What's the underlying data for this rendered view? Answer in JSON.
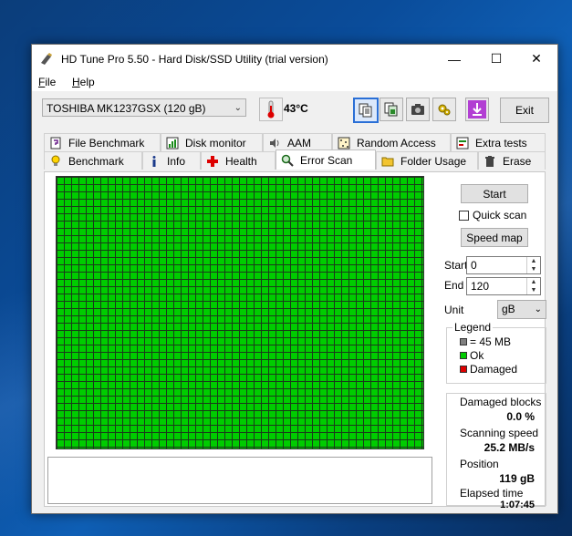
{
  "window": {
    "title": "HD Tune Pro 5.50 - Hard Disk/SSD Utility (trial version)"
  },
  "controls": {
    "minimize": "—",
    "maximize": "☐",
    "close": "✕"
  },
  "menu": [
    {
      "key": "F",
      "rest": "ile"
    },
    {
      "key": "H",
      "rest": "elp"
    }
  ],
  "drive": {
    "selected": "TOSHIBA MK1237GSX (120 gB)"
  },
  "temperature": "43°C",
  "exit_label": "Exit",
  "tabs_top": [
    "File Benchmark",
    "Disk monitor",
    "AAM",
    "Random Access",
    "Extra tests"
  ],
  "tabs_bottom": [
    "Benchmark",
    "Info",
    "Health",
    "Error Scan",
    "Folder Usage",
    "Erase"
  ],
  "scan": {
    "start_label": "Start",
    "quick_scan_label": "Quick scan",
    "speed_map_label": "Speed map",
    "start_field_label": "Start",
    "start_value": "0",
    "end_field_label": "End",
    "end_value": "120",
    "unit_label": "Unit",
    "unit_value": "gB"
  },
  "legend": {
    "title": "Legend",
    "block_size": "= 45 MB",
    "ok": "Ok",
    "damaged": "Damaged"
  },
  "stats": {
    "damaged_blocks_label": "Damaged blocks",
    "damaged_blocks_value": "0.0 %",
    "scanning_speed_label": "Scanning speed",
    "scanning_speed_value": "25.2 MB/s",
    "position_label": "Position",
    "position_value": "119 gB",
    "elapsed_label": "Elapsed time",
    "elapsed_value": "1:07:45"
  },
  "colors": {
    "ok": "#00cc00",
    "damaged": "#dd0000",
    "block": "#808080"
  }
}
